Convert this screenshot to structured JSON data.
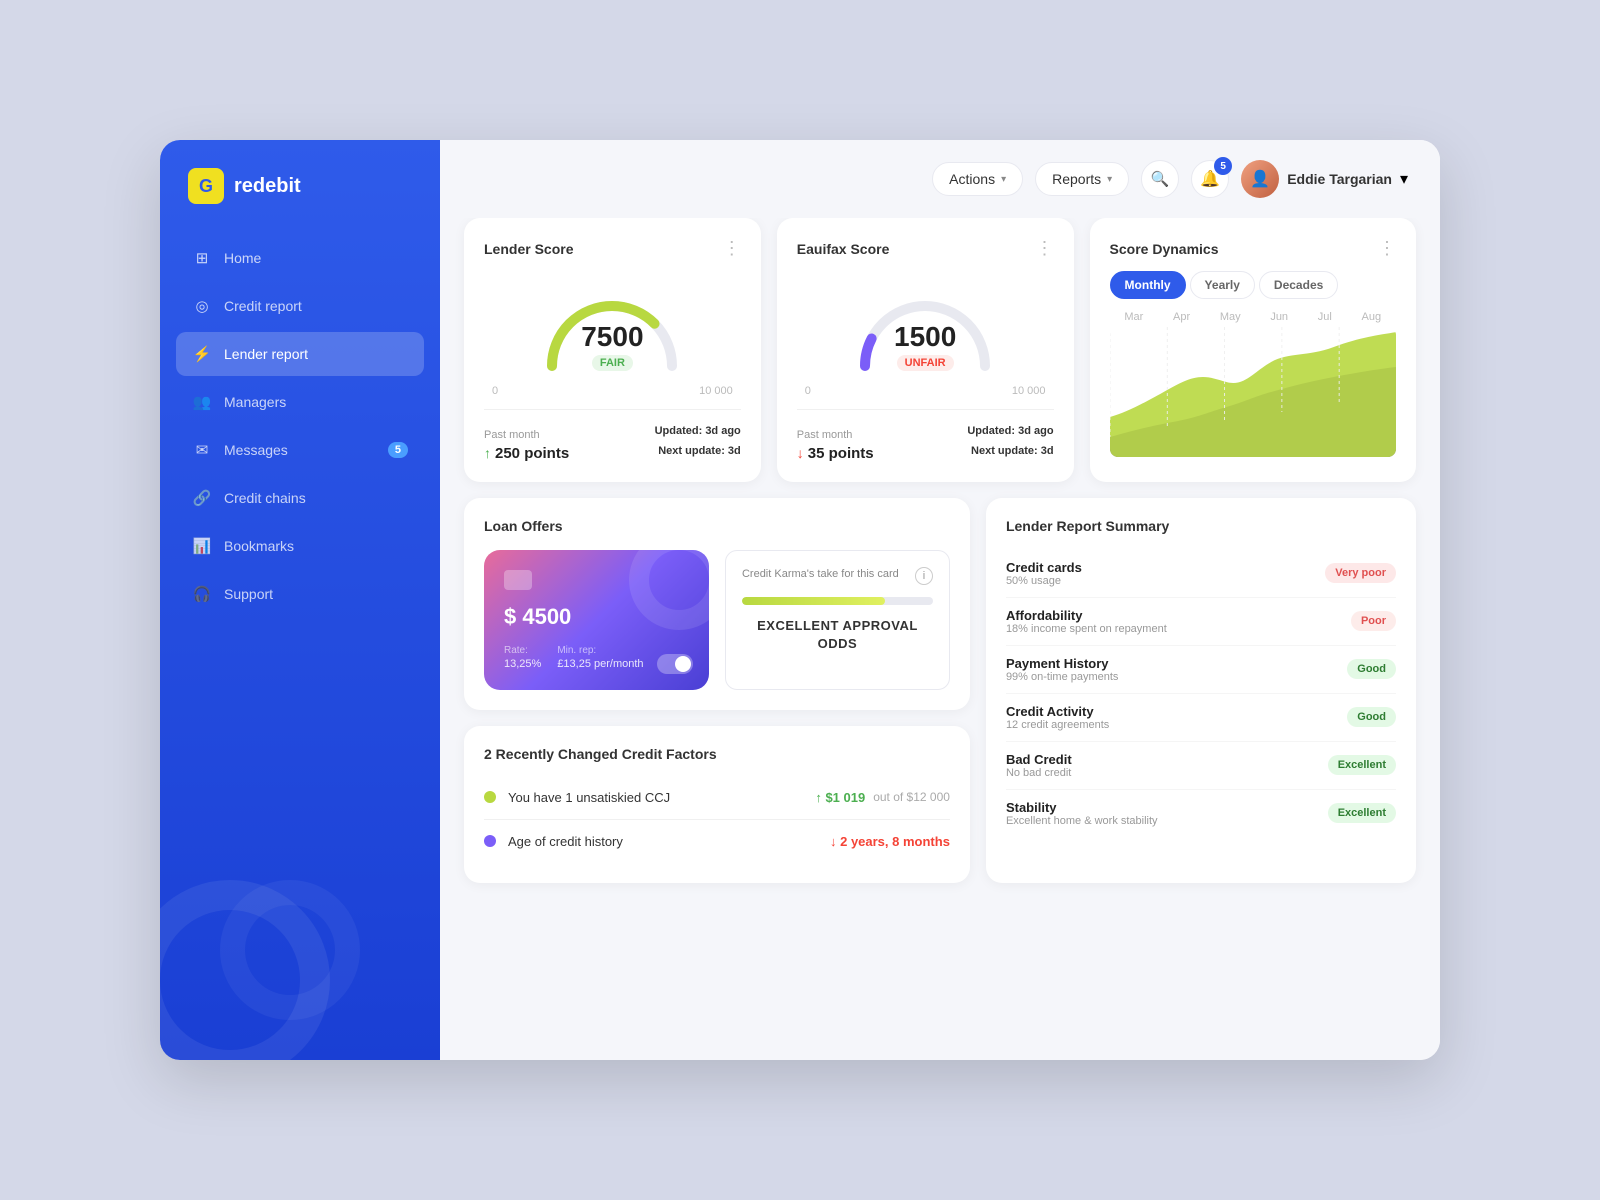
{
  "app": {
    "name": "redebit",
    "logo_letter": "G"
  },
  "sidebar": {
    "items": [
      {
        "id": "home",
        "label": "Home",
        "icon": "⊞",
        "active": false
      },
      {
        "id": "credit-report",
        "label": "Credit report",
        "icon": "◎",
        "active": false
      },
      {
        "id": "lender-report",
        "label": "Lender report",
        "icon": "⚡",
        "active": true
      },
      {
        "id": "managers",
        "label": "Managers",
        "icon": "👥",
        "active": false
      },
      {
        "id": "messages",
        "label": "Messages",
        "icon": "✉",
        "active": false,
        "badge": "5"
      },
      {
        "id": "credit-chains",
        "label": "Credit chains",
        "icon": "🔗",
        "active": false
      },
      {
        "id": "bookmarks",
        "label": "Bookmarks",
        "icon": "📊",
        "active": false
      },
      {
        "id": "support",
        "label": "Support",
        "icon": "🎧",
        "active": false
      }
    ]
  },
  "header": {
    "actions_label": "Actions",
    "reports_label": "Reports",
    "notifications_count": "5",
    "user_name": "Eddie Targarian"
  },
  "lender_score": {
    "title": "Lender Score",
    "value": "7500",
    "status": "FAIR",
    "range_min": "0",
    "range_max": "10 000",
    "past_label": "Past month",
    "points_change": "250 points",
    "updated_label": "Updated:",
    "updated_value": "3d ago",
    "next_update_label": "Next update:",
    "next_update_value": "3d",
    "gauge_color": "#b8d840",
    "gauge_pct": 0.75,
    "direction": "up"
  },
  "equifax_score": {
    "title": "Eauifax Score",
    "value": "1500",
    "status": "UNFAIR",
    "range_min": "0",
    "range_max": "10 000",
    "past_label": "Past month",
    "points_change": "35 points",
    "updated_label": "Updated:",
    "updated_value": "3d ago",
    "next_update_label": "Next update:",
    "next_update_value": "3d",
    "gauge_color": "#7b5ef8",
    "gauge_pct": 0.15,
    "direction": "down"
  },
  "score_dynamics": {
    "title": "Score Dynamics",
    "tabs": [
      "Monthly",
      "Yearly",
      "Decades"
    ],
    "active_tab": "Monthly",
    "months": [
      "Mar",
      "Apr",
      "May",
      "Jun",
      "Jul",
      "Aug"
    ]
  },
  "loan_offers": {
    "title": "Loan Offers",
    "card": {
      "amount": "$ 4500",
      "rate_label": "Rate:",
      "rate_value": "13,25%",
      "min_rep_label": "Min. rep:",
      "min_rep_value": "£13,25 per/month"
    },
    "karma_take": "Credit Karma's take for this card",
    "approval_odds": "EXCELLENT APPROVAL ODDS"
  },
  "ccj_section": {
    "title": "2 Recently Changed Credit Factors",
    "items": [
      {
        "dot_color": "#b8d840",
        "text": "You have 1 unsatiskied CCJ",
        "amount": "↑ $1 019",
        "limit": "out of $12 000",
        "direction": "up"
      },
      {
        "dot_color": "#7b5ef8",
        "text": "Age of credit history",
        "amount": "↓ 2 years, 8 months",
        "limit": "",
        "direction": "down"
      }
    ]
  },
  "lender_summary": {
    "title": "Lender Report Summary",
    "items": [
      {
        "name": "Credit cards",
        "sub": "50% usage",
        "badge": "Very poor",
        "badge_type": "verypoor"
      },
      {
        "name": "Affordability",
        "sub": "18% income spent on repayment",
        "badge": "Poor",
        "badge_type": "poor"
      },
      {
        "name": "Payment History",
        "sub": "99% on-time payments",
        "badge": "Good",
        "badge_type": "good"
      },
      {
        "name": "Credit Activity",
        "sub": "12 credit agreements",
        "badge": "Good",
        "badge_type": "good"
      },
      {
        "name": "Bad Credit",
        "sub": "No bad credit",
        "badge": "Excellent",
        "badge_type": "excellent"
      },
      {
        "name": "Stability",
        "sub": "Excellent home & work stability",
        "badge": "Excellent",
        "badge_type": "excellent"
      }
    ]
  }
}
